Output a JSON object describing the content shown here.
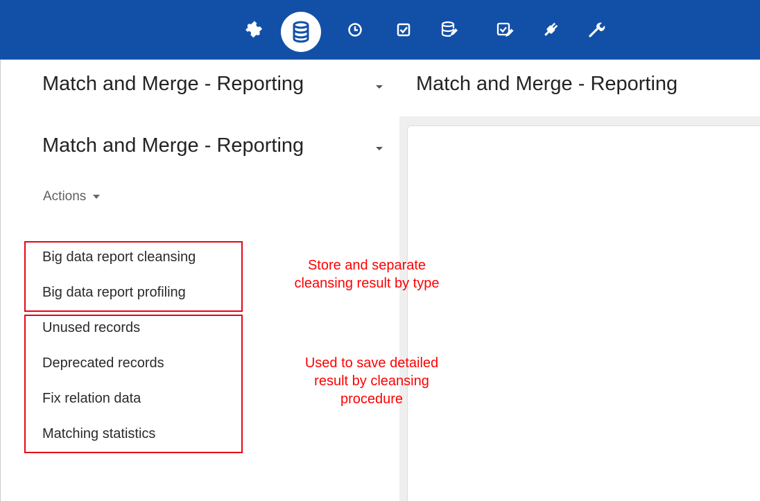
{
  "toolbar": {
    "icons": [
      {
        "name": "puzzle-icon",
        "active": false
      },
      {
        "name": "database-icon",
        "active": true
      },
      {
        "name": "clock-icon",
        "active": false
      },
      {
        "name": "checkbox-icon",
        "active": false
      },
      {
        "name": "database-edit-icon",
        "active": false
      },
      {
        "name": "checkbox-edit-icon",
        "active": false
      },
      {
        "name": "plug-icon",
        "active": false
      },
      {
        "name": "wrench-icon",
        "active": false
      }
    ],
    "background_color": "#1250a8"
  },
  "header": {
    "module_select_label": "Match and Merge - Reporting",
    "page_title": "Match and Merge - Reporting"
  },
  "sidebar": {
    "report_select_label": "Match and Merge - Reporting",
    "actions_label": "Actions",
    "items": [
      {
        "label": "Big data report cleansing"
      },
      {
        "label": "Big data report profiling"
      },
      {
        "label": "Unused records"
      },
      {
        "label": "Deprecated records"
      },
      {
        "label": "Fix relation data"
      },
      {
        "label": "Matching statistics"
      }
    ]
  },
  "annotations": {
    "group_1": [
      "Store and separate",
      "cleansing result by type"
    ],
    "group_2": [
      "Used to save detailed",
      "result by cleansing",
      "procedure"
    ],
    "color": "#ff0000"
  }
}
